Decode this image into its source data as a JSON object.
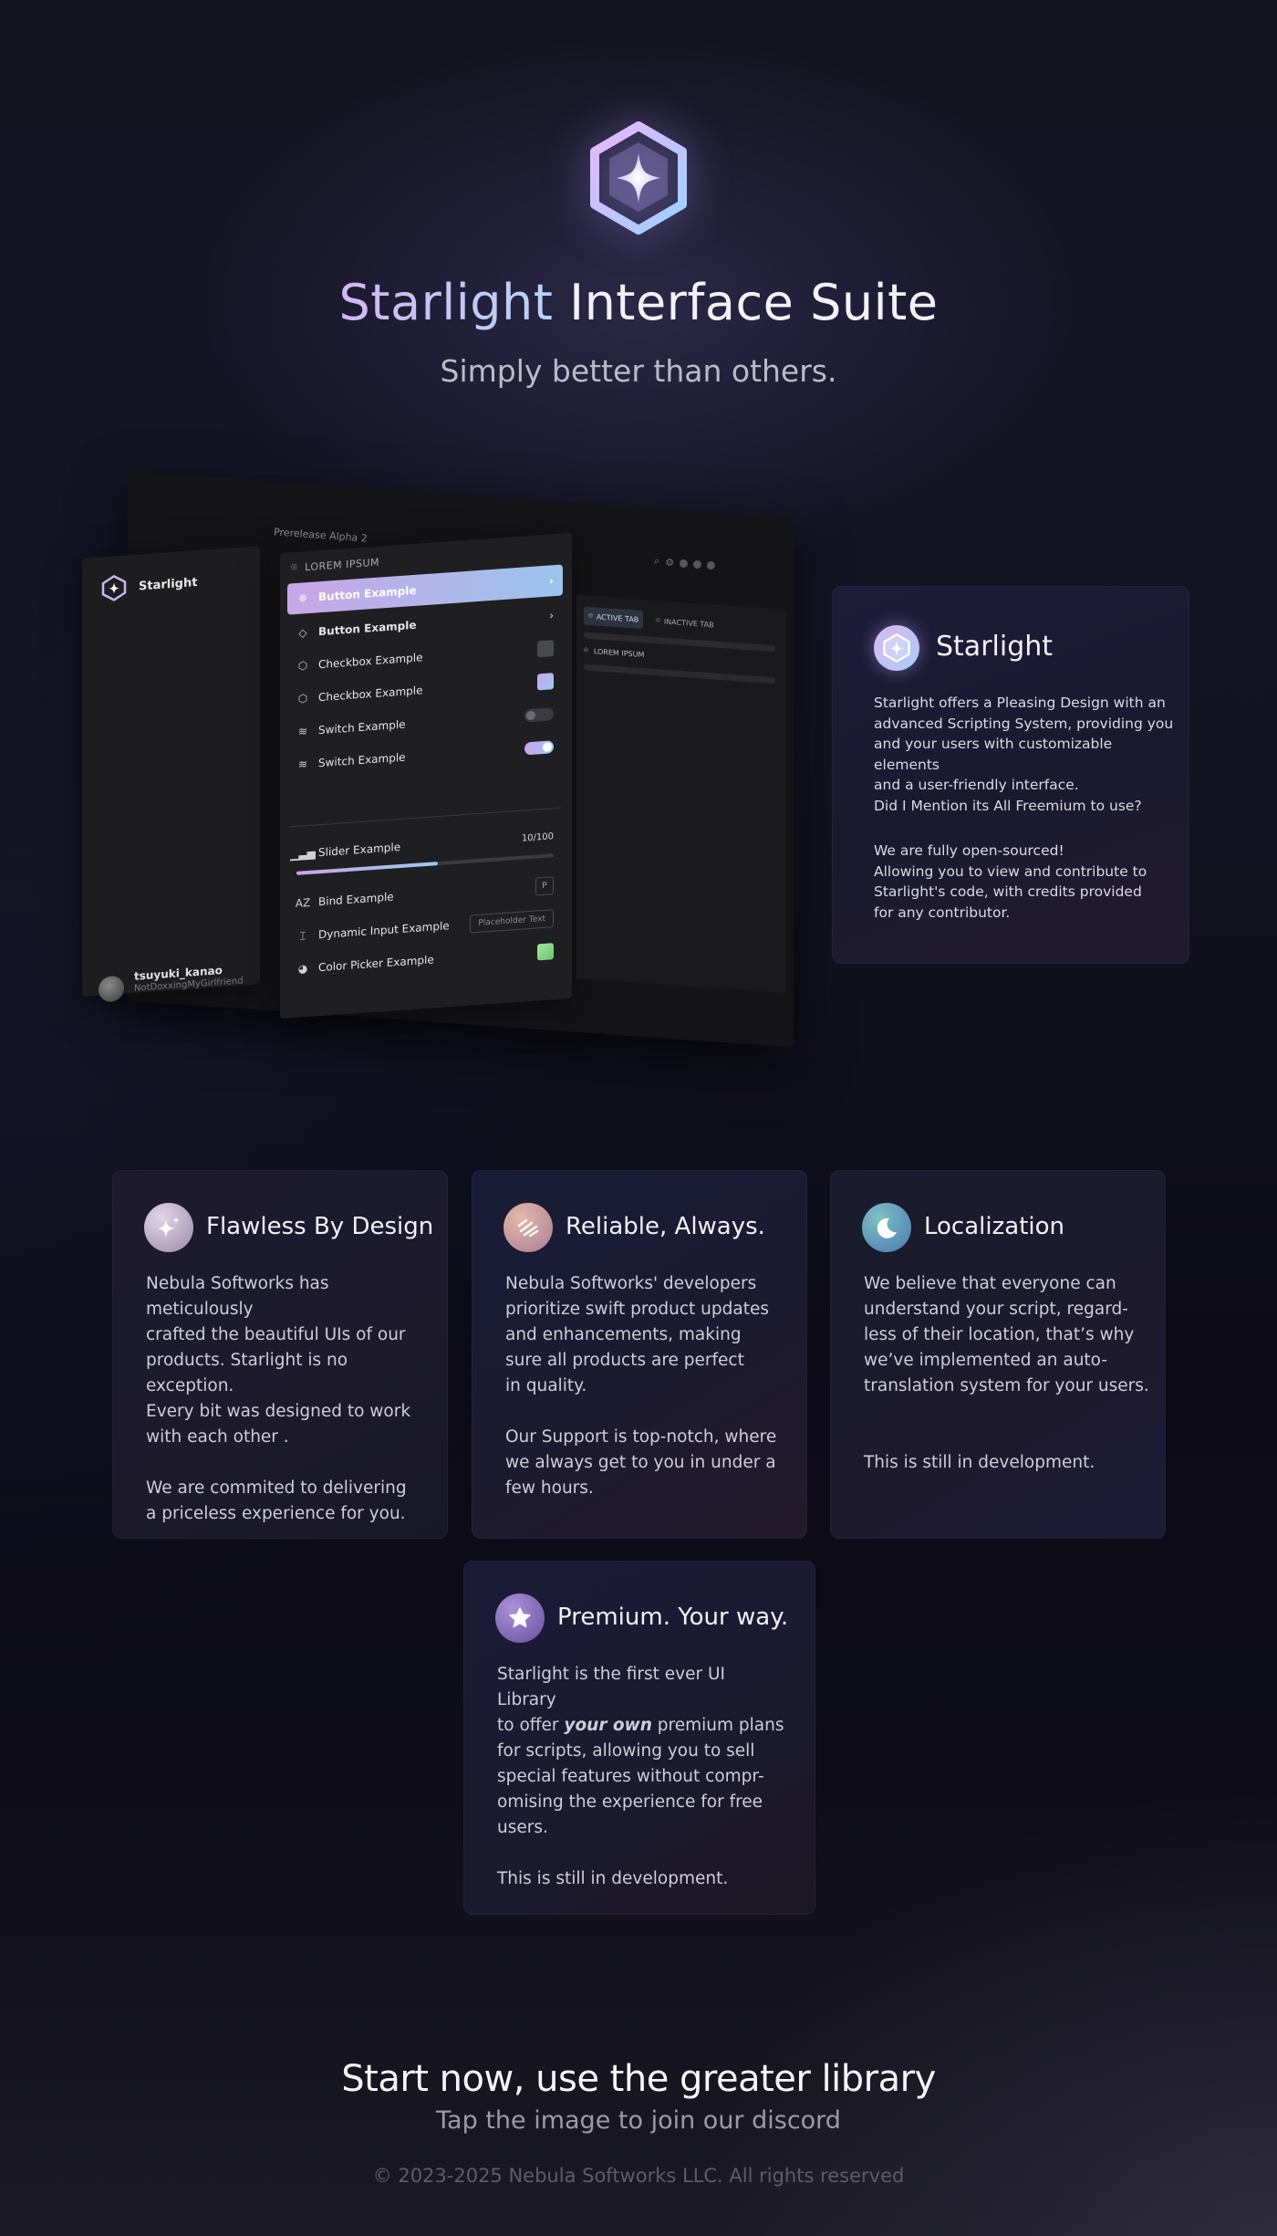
{
  "hero": {
    "title_accent": "Starlight",
    "title_rest": "Interface Suite",
    "subtitle": "Simply better than others."
  },
  "mockup": {
    "prerelease_label": "Prerelease Alpha 2",
    "sidebar_title": "Starlight",
    "user_name": "tsuyuki_kanao",
    "user_handle": "NotDoxxingMyGirlfriend",
    "section_header": "LOREM IPSUM",
    "items": {
      "button1": "Button Example",
      "button2": "Button Example",
      "checkbox1": "Checkbox Example",
      "checkbox2": "Checkbox Example",
      "switch1": "Switch Example",
      "switch2": "Switch Example",
      "slider": "Slider Example",
      "slider_value": "10/100",
      "bind": "Bind Example",
      "bind_key": "P",
      "dynamic_input": "Dynamic Input Example",
      "dynamic_placeholder": "Placeholder Text",
      "color_picker": "Color Picker Example"
    },
    "slider_fraction": 0.55,
    "tabs": {
      "active": "ACTIVE TAB",
      "inactive": "INACTIVE TAB",
      "item": "LOREM IPSUM"
    }
  },
  "starlight_card": {
    "title": "Starlight",
    "paragraph1": "Starlight offers a Pleasing Design with an\nadvanced Scripting System, providing you\nand your users with customizable elements\nand a user-friendly interface.\nDid I Mention its All Freemium to use?",
    "paragraph2": "We are fully open-sourced!\nAllowing you to view and contribute to\nStarlight's code, with credits provided\nfor any contributor."
  },
  "features": [
    {
      "title": "Flawless By Design",
      "body": "Nebula Softworks has meticulously\ncrafted the beautiful UIs of our\nproducts. Starlight is no exception.\nEvery bit was designed to work\nwith each other .\n\nWe are commited to delivering\na priceless experience for you.",
      "icon": "sparkles-icon",
      "color": "#bfb0c8"
    },
    {
      "title": "Reliable, Always.",
      "body": "Nebula Softworks' developers\nprioritize swift product updates\nand enhancements, making\nsure all products are perfect\nin quality.\n\nOur Support is top-notch, where\nwe always get to you in under a\nfew hours.",
      "icon": "stripes-icon",
      "color": "#c79da0"
    },
    {
      "title": "Localization",
      "body": "We believe that everyone can\nunderstand your script, regard-\nless of their location, that’s why\nwe’ve implemented an auto-\ntranslation system for your users.\n\n\nThis is still in development.",
      "icon": "moon-icon",
      "color": "#5f9cb5"
    }
  ],
  "premium": {
    "title": "Premium. Your way.",
    "body_before": "Starlight is the first ever UI Library\nto offer ",
    "body_emphasis": "your own",
    "body_after": " premium plans\nfor scripts, allowing you to sell\nspecial features without compr-\nomising the experience for free\nusers.\n\nThis is still in development.",
    "icon": "star-icon",
    "color": "#7c64b0"
  },
  "footer": {
    "cta_title": "Start now, use the greater library",
    "cta_subtitle": "Tap the image to join our discord",
    "copyright": "© 2023-2025 Nebula Softworks LLC. All rights reserved"
  }
}
